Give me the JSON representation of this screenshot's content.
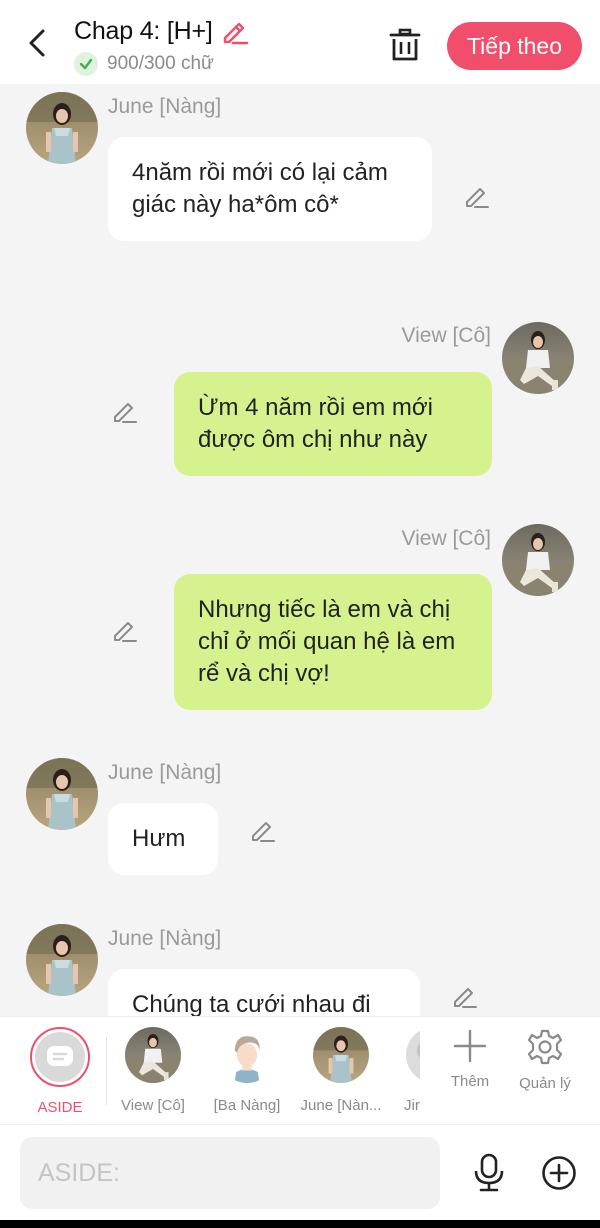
{
  "header": {
    "title": "Chap 4: [H+]",
    "word_count": "900/300 chữ",
    "next_label": "Tiếp theo",
    "accent_color": "#f04e6a"
  },
  "messages": [
    {
      "side": "left",
      "sender": "June [Nàng]",
      "text": "4năm rồi mới có lại cảm giác này ha*ôm cô*",
      "avatar": "june-avatar"
    },
    {
      "side": "right",
      "sender": "View [Cô]",
      "text": "Ừm 4 năm rồi em mới được ôm chị như này",
      "avatar": "view-avatar"
    },
    {
      "side": "right",
      "sender": "View [Cô]",
      "text": "Nhưng tiếc là em và chị chỉ ở mối quan hệ là em rể và chị vợ!",
      "avatar": "view-avatar"
    },
    {
      "side": "left",
      "sender": "June [Nàng]",
      "text": "Hưm",
      "avatar": "june-avatar"
    },
    {
      "side": "left",
      "sender": "June [Nàng]",
      "text": "Chúng ta cưới nhau đi",
      "avatar": "june-avatar"
    }
  ],
  "characters": {
    "aside_label": "ASIDE",
    "items": [
      {
        "label": "View [Cô]"
      },
      {
        "label": "[Ba Nàng]"
      },
      {
        "label": "June [Nàn..."
      },
      {
        "label": "Jir"
      }
    ],
    "add_label": "Thêm",
    "manage_label": "Quản lý"
  },
  "input": {
    "placeholder": "ASIDE:"
  },
  "colors": {
    "outgoing_bubble": "#d6f28f",
    "incoming_bubble": "#ffffff",
    "accent": "#f04e6a"
  }
}
